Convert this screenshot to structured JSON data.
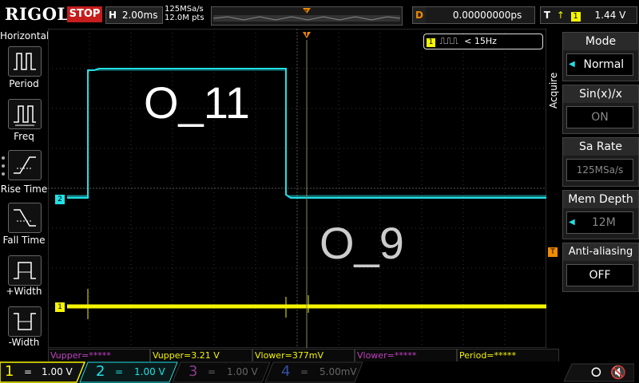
{
  "header": {
    "logo": "RIGOL",
    "run_state": "STOP",
    "horizontal": {
      "key": "H",
      "value": "2.00ms"
    },
    "sample_rate": "125MSa/s",
    "memory_points": "12.0M pts",
    "trigger_marker": "T",
    "delay": {
      "key": "D",
      "value": "0.00000000ps"
    },
    "trigger": {
      "key": "T",
      "channel": "1",
      "level": "1.44 V"
    }
  },
  "left_menu": {
    "title": "Horizontal",
    "items": [
      {
        "label": "Period",
        "icon": "period-icon"
      },
      {
        "label": "Freq",
        "icon": "frequency-icon"
      },
      {
        "label": "Rise Time",
        "icon": "rise-time-icon"
      },
      {
        "label": "Fall Time",
        "icon": "fall-time-icon"
      },
      {
        "label": "+Width",
        "icon": "positive-width-icon"
      },
      {
        "label": "-Width",
        "icon": "negative-width-icon"
      }
    ]
  },
  "right_menu": {
    "side_label": "Acquire",
    "items": [
      {
        "label": "Mode",
        "value": "Normal"
      },
      {
        "label": "Sin(x)/x",
        "value": "ON"
      },
      {
        "label": "Sa Rate",
        "value": "125MSa/s"
      },
      {
        "label": "Mem Depth",
        "value": "12M"
      },
      {
        "label": "Anti-aliasing",
        "value": "OFF"
      }
    ]
  },
  "screen": {
    "freq_badge": {
      "channel": "1",
      "text": "< 15Hz"
    },
    "trace_label_ch2": "O_11",
    "trace_label_ch1": "O_9",
    "ch2_marker": "2",
    "ch1_marker": "1",
    "trigger_top_marker": "T",
    "trigger_level_marker": "T"
  },
  "measurements": [
    "Vupper=*****",
    "Vupper=3.21 V",
    "Vlower=377mV",
    "Vlower=*****",
    "Period=*****"
  ],
  "channels": [
    {
      "num": "1",
      "coupling": "=",
      "scale": "1.00 V",
      "color": "#f5f500",
      "active": true
    },
    {
      "num": "2",
      "coupling": "=",
      "scale": "1.00 V",
      "color": "#00d8e0",
      "active": true
    },
    {
      "num": "3",
      "coupling": "=",
      "scale": "1.00 V",
      "color": "#c040c0",
      "active": false
    },
    {
      "num": "4",
      "coupling": "=",
      "scale": "5.00mV",
      "color": "#2060ff",
      "active": false
    }
  ],
  "colors": {
    "ch1": "#f5f500",
    "ch2": "#22e0e6",
    "trigger": "#f08a00",
    "stop": "#c61c1c"
  }
}
